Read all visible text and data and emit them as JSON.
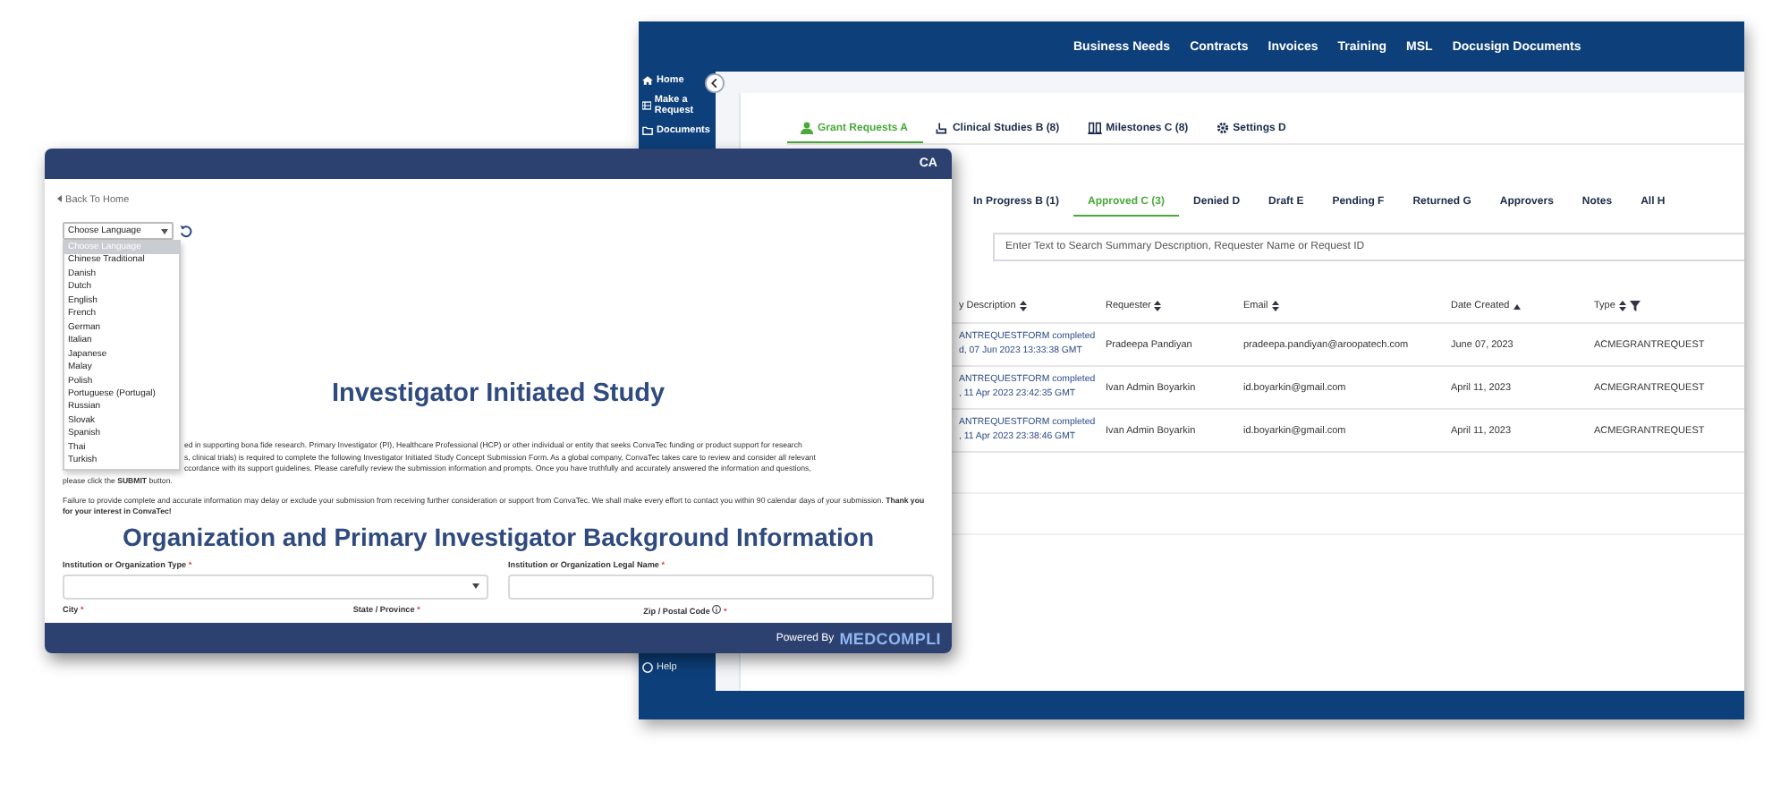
{
  "back_window": {
    "top_nav": [
      "Business Needs",
      "Contracts",
      "Invoices",
      "Training",
      "MSL",
      "Docusign Documents"
    ],
    "sidebar": {
      "items": [
        {
          "label": "Home"
        },
        {
          "label": "Make a Request"
        },
        {
          "label": "Documents"
        }
      ],
      "bottom_item": "Help"
    },
    "tabs": [
      {
        "label": "Grant Requests A",
        "selected": true
      },
      {
        "label": "Clinical Studies B (8)",
        "selected": false
      },
      {
        "label": "Milestones C (8)",
        "selected": false
      },
      {
        "label": "Settings D",
        "selected": false
      }
    ],
    "status_tabs": [
      {
        "label": "In Progress B (1)",
        "selected": false
      },
      {
        "label": "Approved C (3)",
        "selected": true
      },
      {
        "label": "Denied D",
        "selected": false
      },
      {
        "label": "Draft E",
        "selected": false
      },
      {
        "label": "Pending F",
        "selected": false
      },
      {
        "label": "Returned G",
        "selected": false
      },
      {
        "label": "Approvers",
        "selected": false
      },
      {
        "label": "Notes",
        "selected": false
      },
      {
        "label": "All H",
        "selected": false
      }
    ],
    "search": {
      "placeholder": "Enter Text to Search Summary Description, Requester Name or Request ID"
    },
    "table": {
      "columns": [
        {
          "label": "y Description",
          "sorted": false,
          "filter": false
        },
        {
          "label": "Requester",
          "sorted": false,
          "filter": false
        },
        {
          "label": "Email",
          "sorted": false,
          "filter": false
        },
        {
          "label": "Date Created",
          "sorted": true,
          "filter": false
        },
        {
          "label": "Type",
          "sorted": false,
          "filter": true
        }
      ],
      "rows": [
        {
          "description": [
            "ANTREQUESTFORM completed",
            "d, 07 Jun 2023 13:33:38 GMT"
          ],
          "requester": "Pradeepa Pandiyan",
          "email": "pradeepa.pandiyan@aroopatech.com",
          "date": "June 07, 2023",
          "type": "ACMEGRANTREQUEST"
        },
        {
          "description": [
            "ANTREQUESTFORM completed",
            ", 11 Apr 2023 23:42:35 GMT"
          ],
          "requester": "Ivan Admin Boyarkin",
          "email": "id.boyarkin@gmail.com",
          "date": "April 11, 2023",
          "type": "ACMEGRANTREQUEST"
        },
        {
          "description": [
            "ANTREQUESTFORM completed",
            ", 11 Apr 2023 23:38:46 GMT"
          ],
          "requester": "Ivan Admin Boyarkin",
          "email": "id.boyarkin@gmail.com",
          "date": "April 11, 2023",
          "type": "ACMEGRANTREQUEST"
        }
      ]
    }
  },
  "front_window": {
    "title_badge": "CA",
    "back_link": "Back To Home",
    "language_select": {
      "value": "Choose Language",
      "expanded": true,
      "options": [
        {
          "label": "Choose Language",
          "selected": true
        },
        {
          "label": "Chinese Traditional",
          "selected": false
        },
        {
          "label": "Danish",
          "selected": false
        },
        {
          "label": "Dutch",
          "selected": false
        },
        {
          "label": "English",
          "selected": false
        },
        {
          "label": "French",
          "selected": false
        },
        {
          "label": "German",
          "selected": false
        },
        {
          "label": "Italian",
          "selected": false
        },
        {
          "label": "Japanese",
          "selected": false
        },
        {
          "label": "Malay",
          "selected": false
        },
        {
          "label": "Polish",
          "selected": false
        },
        {
          "label": "Portuguese (Portugal)",
          "selected": false
        },
        {
          "label": "Russian",
          "selected": false
        },
        {
          "label": "Slovak",
          "selected": false
        },
        {
          "label": "Spanish",
          "selected": false
        },
        {
          "label": "Thai",
          "selected": false
        },
        {
          "label": "Turkish",
          "selected": false
        }
      ]
    },
    "heading": "Investigator Initiated Study",
    "intro_lines": [
      "ed in supporting bona fide research.   Primary Investigator (PI), Healthcare Professional (HCP) or other individual or entity that seeks ConvaTec funding or product support for research",
      "s, clinical trials) is required to complete the following Investigator Initiated Study Concept Submission Form.  As a global company, ConvaTec takes care to review and consider all relevant",
      "ccordance with its support guidelines.  Please carefully review the submission information and prompts.  Once you have truthfully and accurately answered the information and questions,",
      "please click the **SUBMIT** button."
    ],
    "notice": "Failure to provide complete and accurate information may delay or exclude your submission from receiving further consideration or support from ConvaTec. We shall make every effort to contact you within 90 calendar days of your submission.  **Thank you for your interest in ConvaTec!**",
    "section_heading": "Organization and Primary Investigator Background Information",
    "fields": [
      {
        "label": "Institution or Organization Type",
        "required_mark": "*",
        "kind": "select"
      },
      {
        "label": "Institution or Organization Legal Name",
        "required_mark": "*",
        "kind": "text"
      }
    ],
    "next_labels": [
      {
        "label": "City",
        "required_mark": "*",
        "info": false
      },
      {
        "label": "State / Province",
        "required_mark": "*",
        "info": false
      },
      {
        "label": "Zip / Postal Code",
        "required_mark": "*",
        "info": true
      }
    ],
    "footer": {
      "powered_by": "Powered By",
      "brand": "MEDCOMPLI"
    }
  }
}
